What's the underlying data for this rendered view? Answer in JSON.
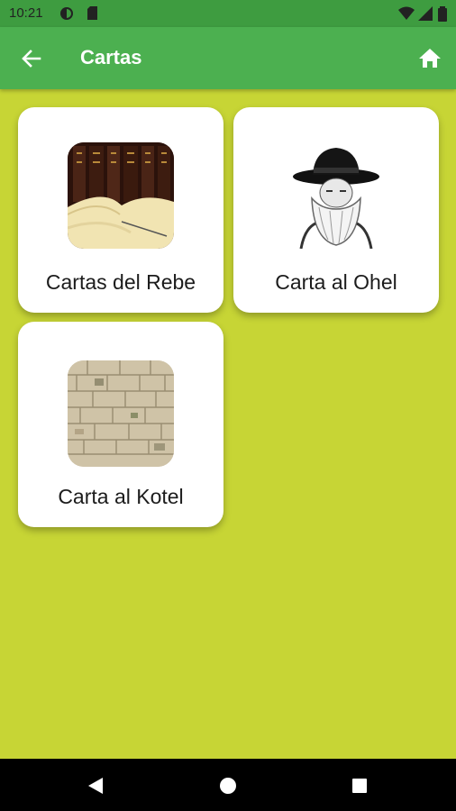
{
  "status": {
    "time": "10:21"
  },
  "app_bar": {
    "title": "Cartas",
    "back_icon": "arrow-left-icon",
    "home_icon": "home-icon"
  },
  "cards": [
    {
      "label": "Cartas del Rebe",
      "image": "books-image"
    },
    {
      "label": "Carta al Ohel",
      "image": "rabbi-portrait-image"
    },
    {
      "label": "Carta al Kotel",
      "image": "wall-stones-image"
    }
  ],
  "nav": {
    "back_icon": "triangle-back-icon",
    "home_icon": "circle-home-icon",
    "recents_icon": "square-recents-icon"
  },
  "colors": {
    "background": "#c7d535",
    "app_bar": "#4cb050",
    "status_bar": "#3e9c40",
    "card": "#ffffff"
  }
}
